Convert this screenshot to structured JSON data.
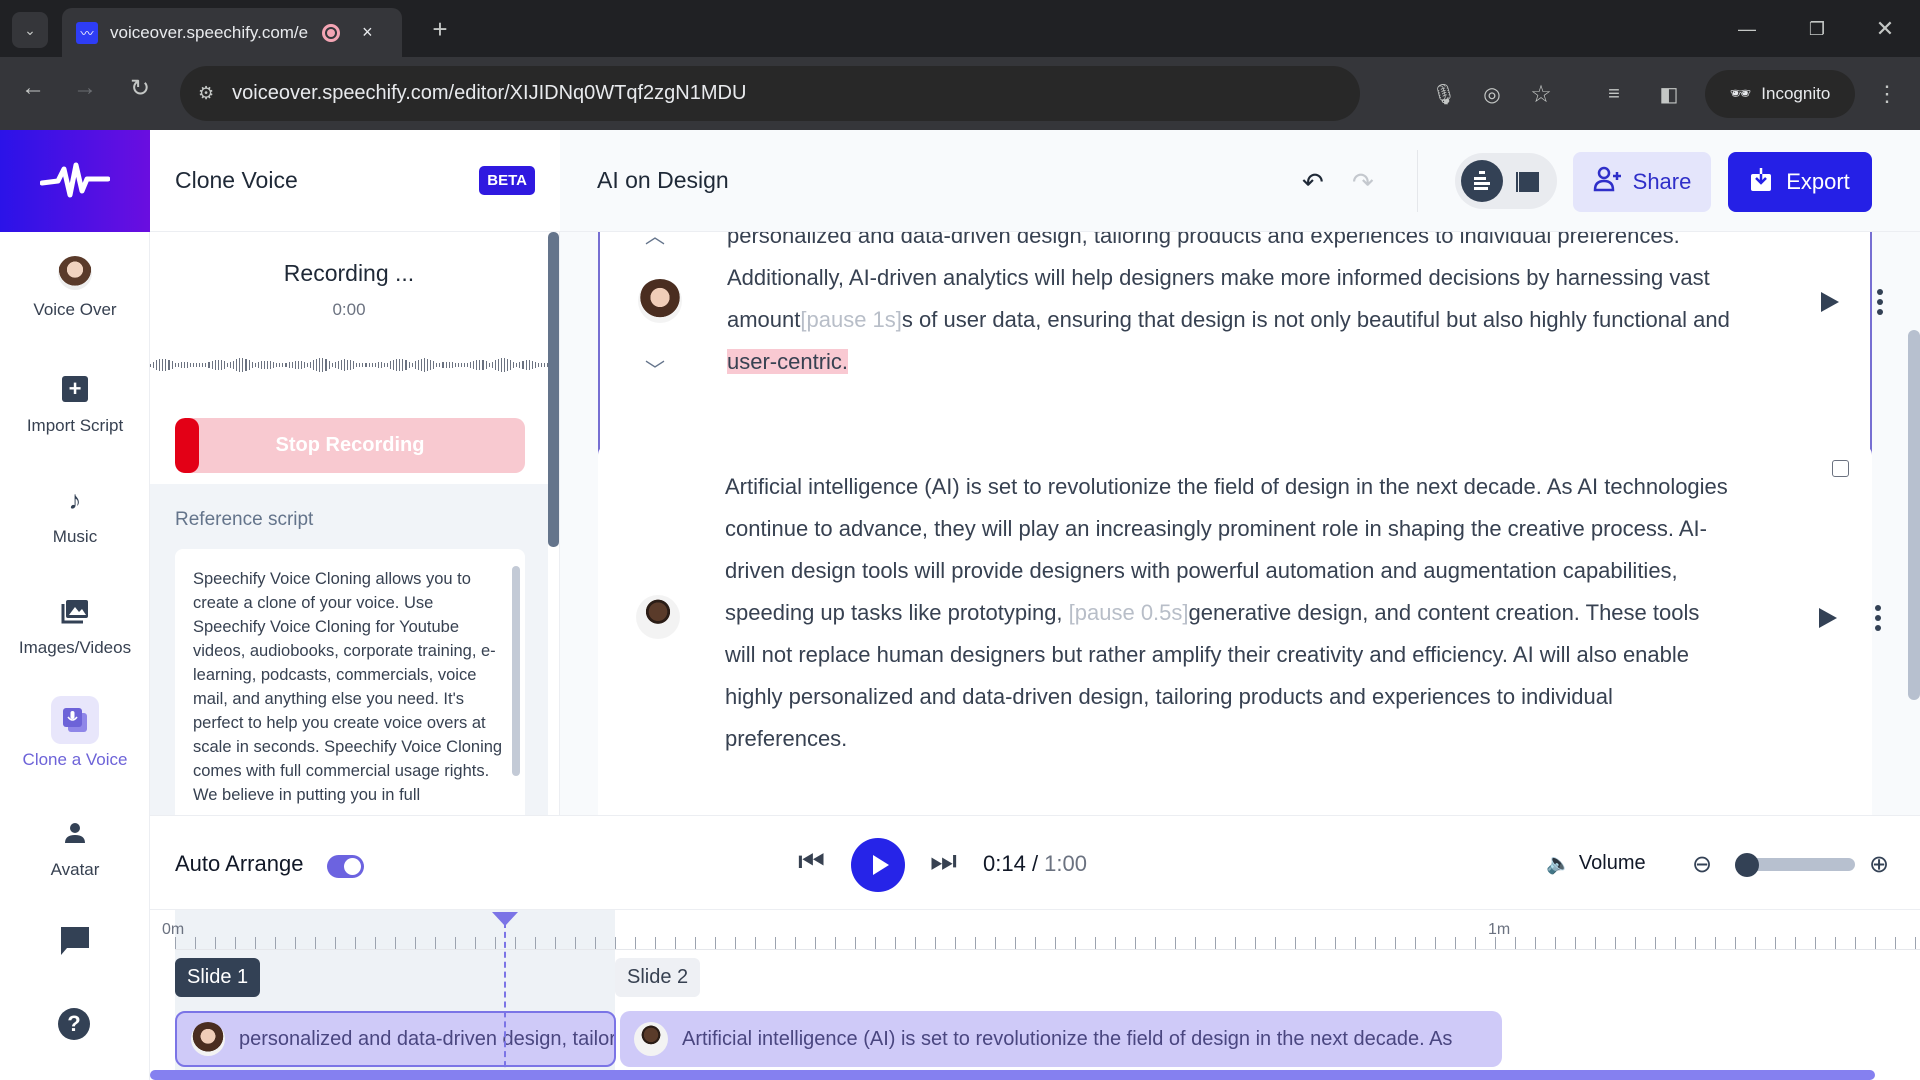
{
  "browser": {
    "tab_title": "voiceover.speechify.com/e",
    "url": "voiceover.speechify.com/editor/XIJIDNq0WTqf2zgN1MDU",
    "incognito_label": "Incognito",
    "new_tab": "+",
    "close_tab": "×"
  },
  "nav": {
    "items": [
      {
        "label": "Voice Over",
        "icon": "avatar-icon"
      },
      {
        "label": "Import Script",
        "icon": "plus-icon"
      },
      {
        "label": "Music",
        "icon": "music-note-icon"
      },
      {
        "label": "Images/Videos",
        "icon": "images-icon"
      },
      {
        "label": "Clone a Voice",
        "icon": "clone-voice-icon",
        "active": true
      },
      {
        "label": "Avatar",
        "icon": "person-icon"
      }
    ]
  },
  "panel": {
    "title": "Clone Voice",
    "badge": "BETA",
    "recording_status": "Recording ...",
    "recording_time": "0:00",
    "stop_button": "Stop Recording",
    "reference_label": "Reference script",
    "reference_text": "Speechify Voice Cloning allows you to create a clone of your voice. Use Speechify Voice Cloning for Youtube videos, audiobooks, corporate training, e-learning, podcasts, commercials, voice mail, and anything else you need. It's perfect to help you create voice overs at scale in seconds. Speechify Voice Cloning comes with full commercial usage rights. We believe in putting you in full"
  },
  "header": {
    "doc_title": "AI on Design",
    "share_label": "Share",
    "export_label": "Export"
  },
  "blocks": [
    {
      "speaker": "female",
      "text_a": "personalized and data-driven design, tailoring products and experiences to individual preferences. Additionally, AI-driven analytics will help designers make more informed decisions by harnessing vast amount",
      "pause": "[pause 1s]",
      "text_b": "s of user data, ensuring that design is not only beautiful but also highly functional and ",
      "highlight": "user-centric."
    },
    {
      "speaker": "male",
      "text_a": "Artificial intelligence (AI) is set to revolutionize the field of design in the next decade. As AI technologies continue to advance, they will play an increasingly prominent role in shaping the creative process. AI-driven design tools will provide designers with powerful automation and augmentation capabilities, speeding up tasks like prototyping, ",
      "pause": "[pause 0.5s]",
      "text_b": "generative design, and content creation. These tools will not replace human designers but rather amplify their creativity and efficiency. AI will also enable highly personalized and data-driven design, tailoring products and experiences to individual preferences."
    }
  ],
  "player": {
    "auto_arrange_label": "Auto Arrange",
    "auto_arrange_on": true,
    "current_time": "0:14",
    "separator": " / ",
    "duration": "1:00",
    "volume_label": "Volume",
    "zoom_level_fraction": 0.0
  },
  "timeline": {
    "ruler_labels": [
      "0m",
      "1m"
    ],
    "playhead_time": "0:14",
    "slides": [
      {
        "label": "Slide 1",
        "clip_text": "personalized and data-driven design, tailoring products and experiences"
      },
      {
        "label": "Slide 2",
        "clip_text": "Artificial intelligence (AI) is set to revolutionize the field of design in the next decade. As"
      }
    ]
  }
}
